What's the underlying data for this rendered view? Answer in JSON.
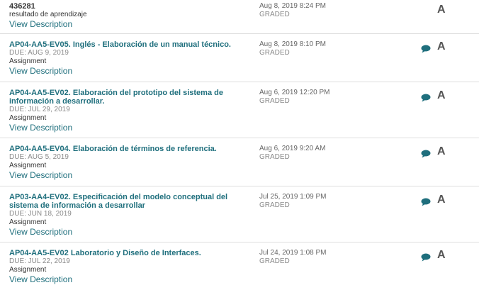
{
  "view_description_label": "View Description",
  "rows": [
    {
      "title": "436281",
      "due": "",
      "type": "resultado de aprendizaje",
      "date": "Aug 8, 2019 8:24 PM",
      "status": "GRADED",
      "grade": "A",
      "has_comment": false
    },
    {
      "title": "AP04-AA5-EV05. Inglés - Elaboración de un manual técnico.",
      "due": "DUE: AUG 9, 2019",
      "type": "Assignment",
      "date": "Aug 8, 2019 8:10 PM",
      "status": "GRADED",
      "grade": "A",
      "has_comment": true
    },
    {
      "title": "AP04-AA5-EV02. Elaboración del prototipo del sistema de información a desarrollar.",
      "due": "DUE: JUL 29, 2019",
      "type": "Assignment",
      "date": "Aug 6, 2019 12:20 PM",
      "status": "GRADED",
      "grade": "A",
      "has_comment": true
    },
    {
      "title": "AP04-AA5-EV04. Elaboración de términos de referencia.",
      "due": "DUE: AUG 5, 2019",
      "type": "Assignment",
      "date": "Aug 6, 2019 9:20 AM",
      "status": "GRADED",
      "grade": "A",
      "has_comment": true
    },
    {
      "title": "AP03-AA4-EV02. Especificación del modelo conceptual del sistema de información a desarrollar",
      "due": "DUE: JUN 18, 2019",
      "type": "Assignment",
      "date": "Jul 25, 2019 1:09 PM",
      "status": "GRADED",
      "grade": "A",
      "has_comment": true
    },
    {
      "title": "AP04-AA5-EV02 Laboratorio y Diseño de Interfaces.",
      "due": "DUE: JUL 22, 2019",
      "type": "Assignment",
      "date": "Jul 24, 2019 1:08 PM",
      "status": "GRADED",
      "grade": "A",
      "has_comment": true
    }
  ],
  "colors": {
    "link": "#1f6f7d",
    "comment_icon": "#1f6f7d",
    "divider": "#dedede"
  }
}
